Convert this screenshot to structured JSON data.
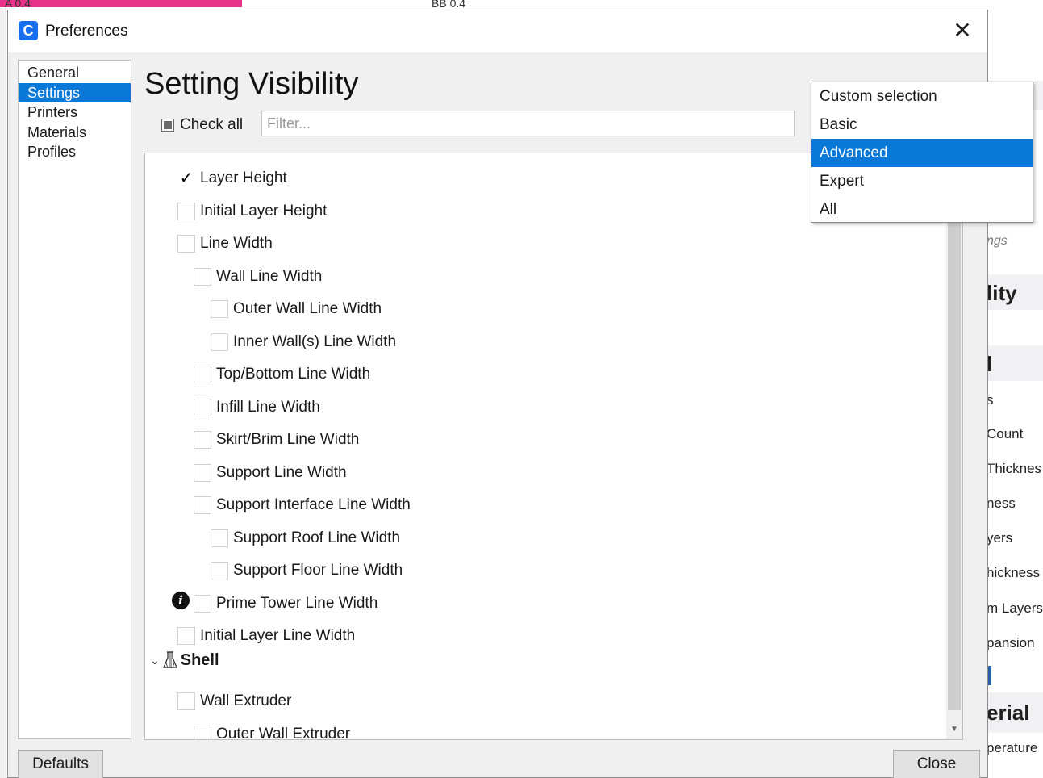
{
  "background": {
    "top_texts": [
      "A 0.4",
      "BB 0.4"
    ],
    "right_panel": {
      "texts": [
        "ngs",
        "lity",
        "l",
        "s",
        "Count",
        "Thicknes",
        "ness",
        "yers",
        "hickness",
        "m Layers",
        "pansion",
        "erial",
        "perature"
      ]
    }
  },
  "dialog": {
    "title": "Preferences",
    "close_symbol": "✕",
    "logo_letter": "C"
  },
  "nav": {
    "items": [
      {
        "label": "General"
      },
      {
        "label": "Settings"
      },
      {
        "label": "Printers"
      },
      {
        "label": "Materials"
      },
      {
        "label": "Profiles"
      }
    ],
    "selected": "Settings"
  },
  "content": {
    "title": "Setting Visibility",
    "check_all_label": "Check all",
    "filter_placeholder": "Filter..."
  },
  "settings": [
    {
      "label": "Layer Height",
      "checked": true
    },
    {
      "label": "Initial Layer Height",
      "checked": false
    },
    {
      "label": "Line Width",
      "checked": false
    },
    {
      "label": "Wall Line Width",
      "checked": false
    },
    {
      "label": "Outer Wall Line Width",
      "checked": false
    },
    {
      "label": "Inner Wall(s) Line Width",
      "checked": false
    },
    {
      "label": "Top/Bottom Line Width",
      "checked": false
    },
    {
      "label": "Infill Line Width",
      "checked": false
    },
    {
      "label": "Skirt/Brim Line Width",
      "checked": false
    },
    {
      "label": "Support Line Width",
      "checked": false
    },
    {
      "label": "Support Interface Line Width",
      "checked": false
    },
    {
      "label": "Support Roof Line Width",
      "checked": false
    },
    {
      "label": "Support Floor Line Width",
      "checked": false
    },
    {
      "label": "Prime Tower Line Width",
      "checked": false,
      "info": true
    },
    {
      "label": "Initial Layer Line Width",
      "checked": false
    },
    {
      "label": "Wall Extruder",
      "checked": false
    },
    {
      "label": "Outer Wall Extruder",
      "checked": false
    }
  ],
  "category": {
    "label": "Shell",
    "expanded": true
  },
  "info_symbol": "i",
  "check_symbol": "✓",
  "chevron_symbol": "⌄",
  "buttons": {
    "defaults": "Defaults",
    "close": "Close"
  },
  "dropdown": {
    "options": [
      "Custom selection",
      "Basic",
      "Advanced",
      "Expert",
      "All"
    ],
    "selected": "Advanced"
  },
  "colors": {
    "accent": "#0a78d7",
    "brand": "#196ef0",
    "pink": "#e8318a"
  }
}
